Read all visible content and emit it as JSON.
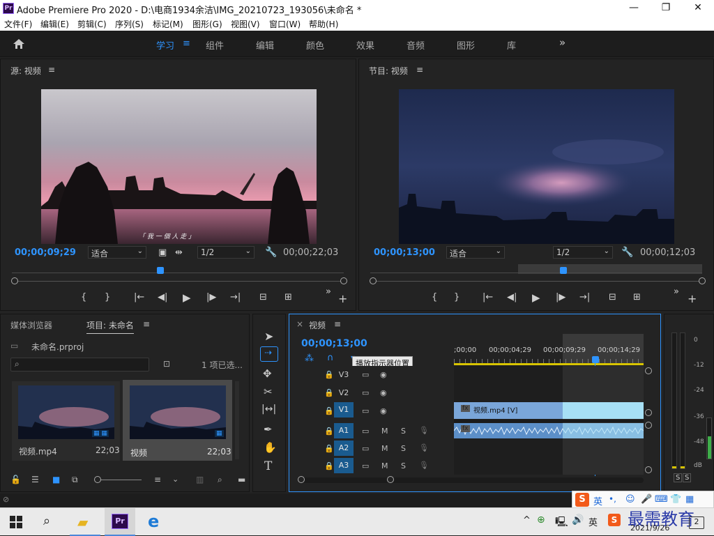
{
  "window": {
    "app_icon": "Pr",
    "title": "Adobe Premiere Pro 2020 - D:\\电商1934余洁\\IMG_20210723_193056\\未命名 *",
    "controls": [
      "minimize-icon",
      "maximize-icon",
      "close-icon"
    ]
  },
  "menu": [
    "文件(F)",
    "编辑(E)",
    "剪辑(C)",
    "序列(S)",
    "标记(M)",
    "图形(G)",
    "视图(V)",
    "窗口(W)",
    "帮助(H)"
  ],
  "workspaces": {
    "items": [
      "学习",
      "组件",
      "编辑",
      "颜色",
      "效果",
      "音频",
      "图形",
      "库"
    ],
    "active": "学习",
    "more": "»"
  },
  "source_monitor": {
    "title": "源: 视频",
    "caption": "「 我 一 個 人 走 」",
    "timecode_current": "00;00;09;29",
    "fit": "适合",
    "resolution": "1/2",
    "timecode_duration": "00;00;22;03",
    "playhead_fraction": 0.45
  },
  "program_monitor": {
    "title": "节目: 视频",
    "timecode_current": "00;00;13;00",
    "fit": "适合",
    "resolution": "1/2",
    "timecode_duration": "00;00;12;03",
    "playhead_fraction": 0.575
  },
  "transport": {
    "mark_in": "{",
    "mark_out": "}",
    "go_in": "|←",
    "step_back": "◀|",
    "play": "▶",
    "step_fwd": "|▶",
    "go_out": "→|",
    "more": "»",
    "add": "+"
  },
  "project_panel": {
    "tab_media": "媒体浏览器",
    "tab_project": "项目: 未命名",
    "project_file": "未命名.prproj",
    "selection": "1 项已选...",
    "items": [
      {
        "name": "视频.mp4",
        "duration": "22;03"
      },
      {
        "name": "视频",
        "duration": "22;03"
      }
    ]
  },
  "timeline": {
    "close": "×",
    "title": "视频",
    "timecode": "00;00;13;00",
    "ruler": [
      ";00;00",
      "00;00;04;29",
      "00;00;09;29",
      "00;00;14;29"
    ],
    "tooltip": "播放指示器位置",
    "video_tracks": [
      "V3",
      "V2",
      "V1"
    ],
    "audio_tracks": [
      "A1",
      "A2",
      "A3"
    ],
    "mute": "M",
    "solo": "S",
    "clip_video": "视频.mp4 [V]",
    "clip_fx": "fx"
  },
  "audio_meter": {
    "scale": [
      "0",
      "-12",
      "-24",
      "-36",
      "-48",
      "dB"
    ],
    "solo_left": "S",
    "solo_right": "S"
  },
  "tray": {
    "ime_lang": "英",
    "ime_punct": "•,",
    "lang": "英",
    "date": "2021/9/26",
    "watermark": "最需教育",
    "notification_count": "2"
  },
  "colors": {
    "accent": "#2e94ff",
    "panel": "#232323",
    "timeline_clip": "#7aa6d9",
    "timeline_clip_selected": "#a7e0f5",
    "audio_clip": "#5c8fc8"
  }
}
